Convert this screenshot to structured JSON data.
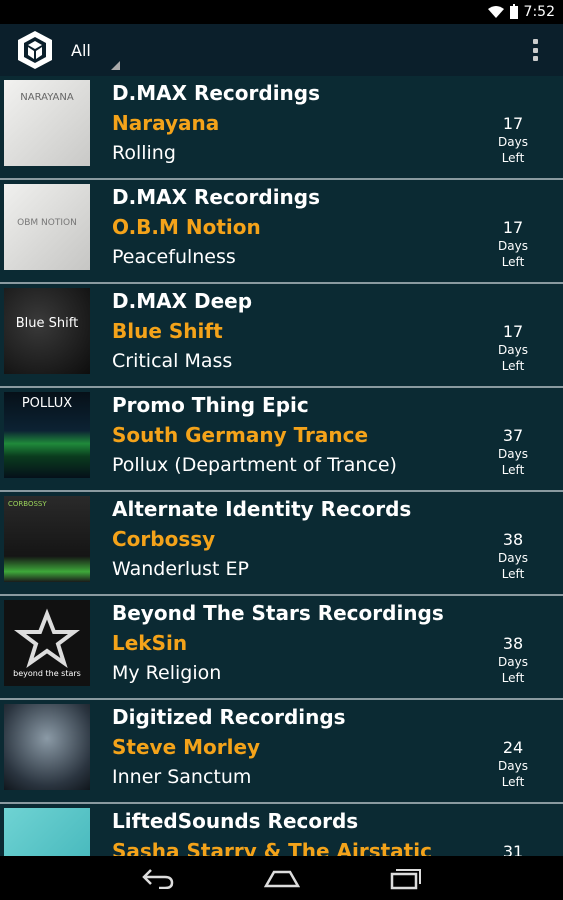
{
  "status_bar": {
    "time": "7:52"
  },
  "action_bar": {
    "filter_label": "All"
  },
  "releases": [
    {
      "label": "D.MAX Recordings",
      "artist": "Narayana",
      "title": "Rolling",
      "days": "17",
      "days_text": "Days Left",
      "cover_text": "NARAYANA"
    },
    {
      "label": "D.MAX Recordings",
      "artist": "O.B.M Notion",
      "title": "Peacefulness",
      "days": "17",
      "days_text": "Days Left",
      "cover_text": "OBM NOTION"
    },
    {
      "label": "D.MAX Deep",
      "artist": "Blue Shift",
      "title": "Critical Mass",
      "days": "17",
      "days_text": "Days Left",
      "cover_text": "Blue Shift"
    },
    {
      "label": "Promo Thing Epic",
      "artist": "South Germany Trance",
      "title": "Pollux (Department of Trance)",
      "days": "37",
      "days_text": "Days Left",
      "cover_text": "POLLUX"
    },
    {
      "label": "Alternate Identity Records",
      "artist": "Corbossy",
      "title": "Wanderlust EP",
      "days": "38",
      "days_text": "Days Left",
      "cover_text": "CORBOSSY"
    },
    {
      "label": "Beyond The Stars Recordings",
      "artist": "LekSin",
      "title": "My Religion",
      "days": "38",
      "days_text": "Days Left",
      "cover_text": "beyond the stars"
    },
    {
      "label": "Digitized Recordings",
      "artist": "Steve Morley",
      "title": "Inner Sanctum",
      "days": "24",
      "days_text": "Days Left",
      "cover_text": ""
    },
    {
      "label": "LiftedSounds Records",
      "artist": "Sasha Starry & The Airstatic",
      "title": "",
      "days": "31",
      "days_text": "",
      "cover_text": ""
    }
  ],
  "colors": {
    "artist": "#f4a31a",
    "background": "#0b2a33",
    "divider": "#8a9aa0"
  }
}
